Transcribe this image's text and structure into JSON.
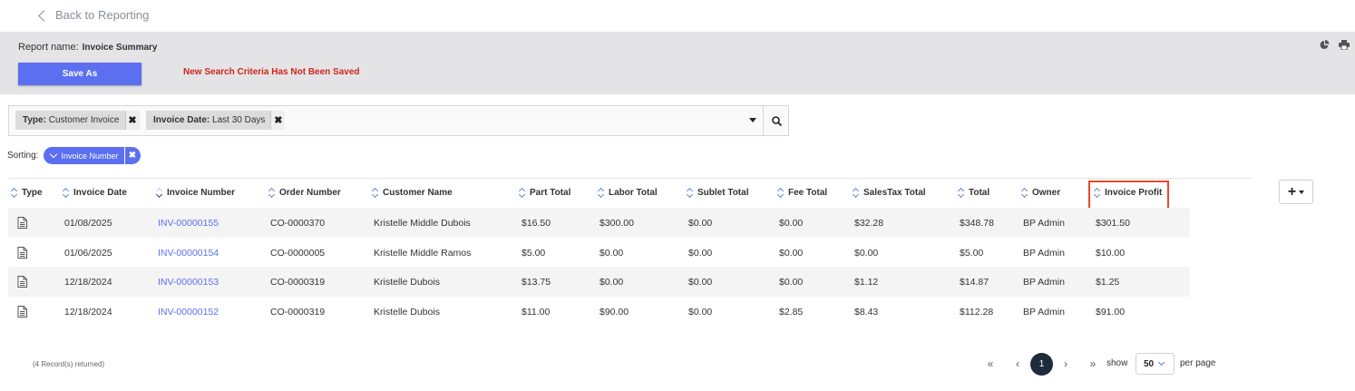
{
  "nav": {
    "back_label": "Back to Reporting"
  },
  "report": {
    "name_label": "Report name:",
    "name_value": "Invoice Summary",
    "save_as_label": "Save As",
    "unsaved_warning": "New Search Criteria Has Not Been Saved"
  },
  "filters": [
    {
      "key": "Type:",
      "value": "Customer Invoice"
    },
    {
      "key": "Invoice Date:",
      "value": "Last 30 Days"
    }
  ],
  "sorting": {
    "label": "Sorting:",
    "field": "Invoice Number"
  },
  "columns": [
    "Type",
    "Invoice Date",
    "Invoice Number",
    "Order Number",
    "Customer Name",
    "Part Total",
    "Labor Total",
    "Sublet Total",
    "Fee Total",
    "SalesTax Total",
    "Total",
    "Owner",
    "Invoice Profit"
  ],
  "rows": [
    {
      "invoice_date": "01/08/2025",
      "invoice_number": "INV-00000155",
      "order_number": "CO-0000370",
      "customer_name": "Kristelle Middle Dubois",
      "part_total": "$16.50",
      "labor_total": "$300.00",
      "sublet_total": "$0.00",
      "fee_total": "$0.00",
      "salestax_total": "$32.28",
      "total": "$348.78",
      "owner": "BP Admin",
      "invoice_profit": "$301.50"
    },
    {
      "invoice_date": "01/06/2025",
      "invoice_number": "INV-00000154",
      "order_number": "CO-0000005",
      "customer_name": "Kristelle Middle Ramos",
      "part_total": "$5.00",
      "labor_total": "$0.00",
      "sublet_total": "$0.00",
      "fee_total": "$0.00",
      "salestax_total": "$0.00",
      "total": "$5.00",
      "owner": "BP Admin",
      "invoice_profit": "$10.00"
    },
    {
      "invoice_date": "12/18/2024",
      "invoice_number": "INV-00000153",
      "order_number": "CO-0000319",
      "customer_name": "Kristelle Dubois",
      "part_total": "$13.75",
      "labor_total": "$0.00",
      "sublet_total": "$0.00",
      "fee_total": "$0.00",
      "salestax_total": "$1.12",
      "total": "$14.87",
      "owner": "BP Admin",
      "invoice_profit": "$1.25"
    },
    {
      "invoice_date": "12/18/2024",
      "invoice_number": "INV-00000152",
      "order_number": "CO-0000319",
      "customer_name": "Kristelle Dubois",
      "part_total": "$11.00",
      "labor_total": "$90.00",
      "sublet_total": "$0.00",
      "fee_total": "$2.85",
      "salestax_total": "$8.43",
      "total": "$112.28",
      "owner": "BP Admin",
      "invoice_profit": "$91.00"
    }
  ],
  "footer": {
    "records_returned": "(4 Record(s) returned)",
    "current_page": "1",
    "show_label": "show",
    "per_page_value": "50",
    "per_page_label": "per page",
    "first_glyph": "«",
    "prev_glyph": "‹",
    "next_glyph": "›",
    "last_glyph": "»"
  },
  "icons": {
    "back": "chevron-left-icon",
    "chart": "pie-chart-icon",
    "print": "print-icon",
    "search": "search-icon",
    "doc": "document-icon"
  },
  "colors": {
    "primary": "#5b6ff0",
    "warning": "#d0251a",
    "highlight": "#e8472b",
    "panel": "#e4e4e6"
  }
}
